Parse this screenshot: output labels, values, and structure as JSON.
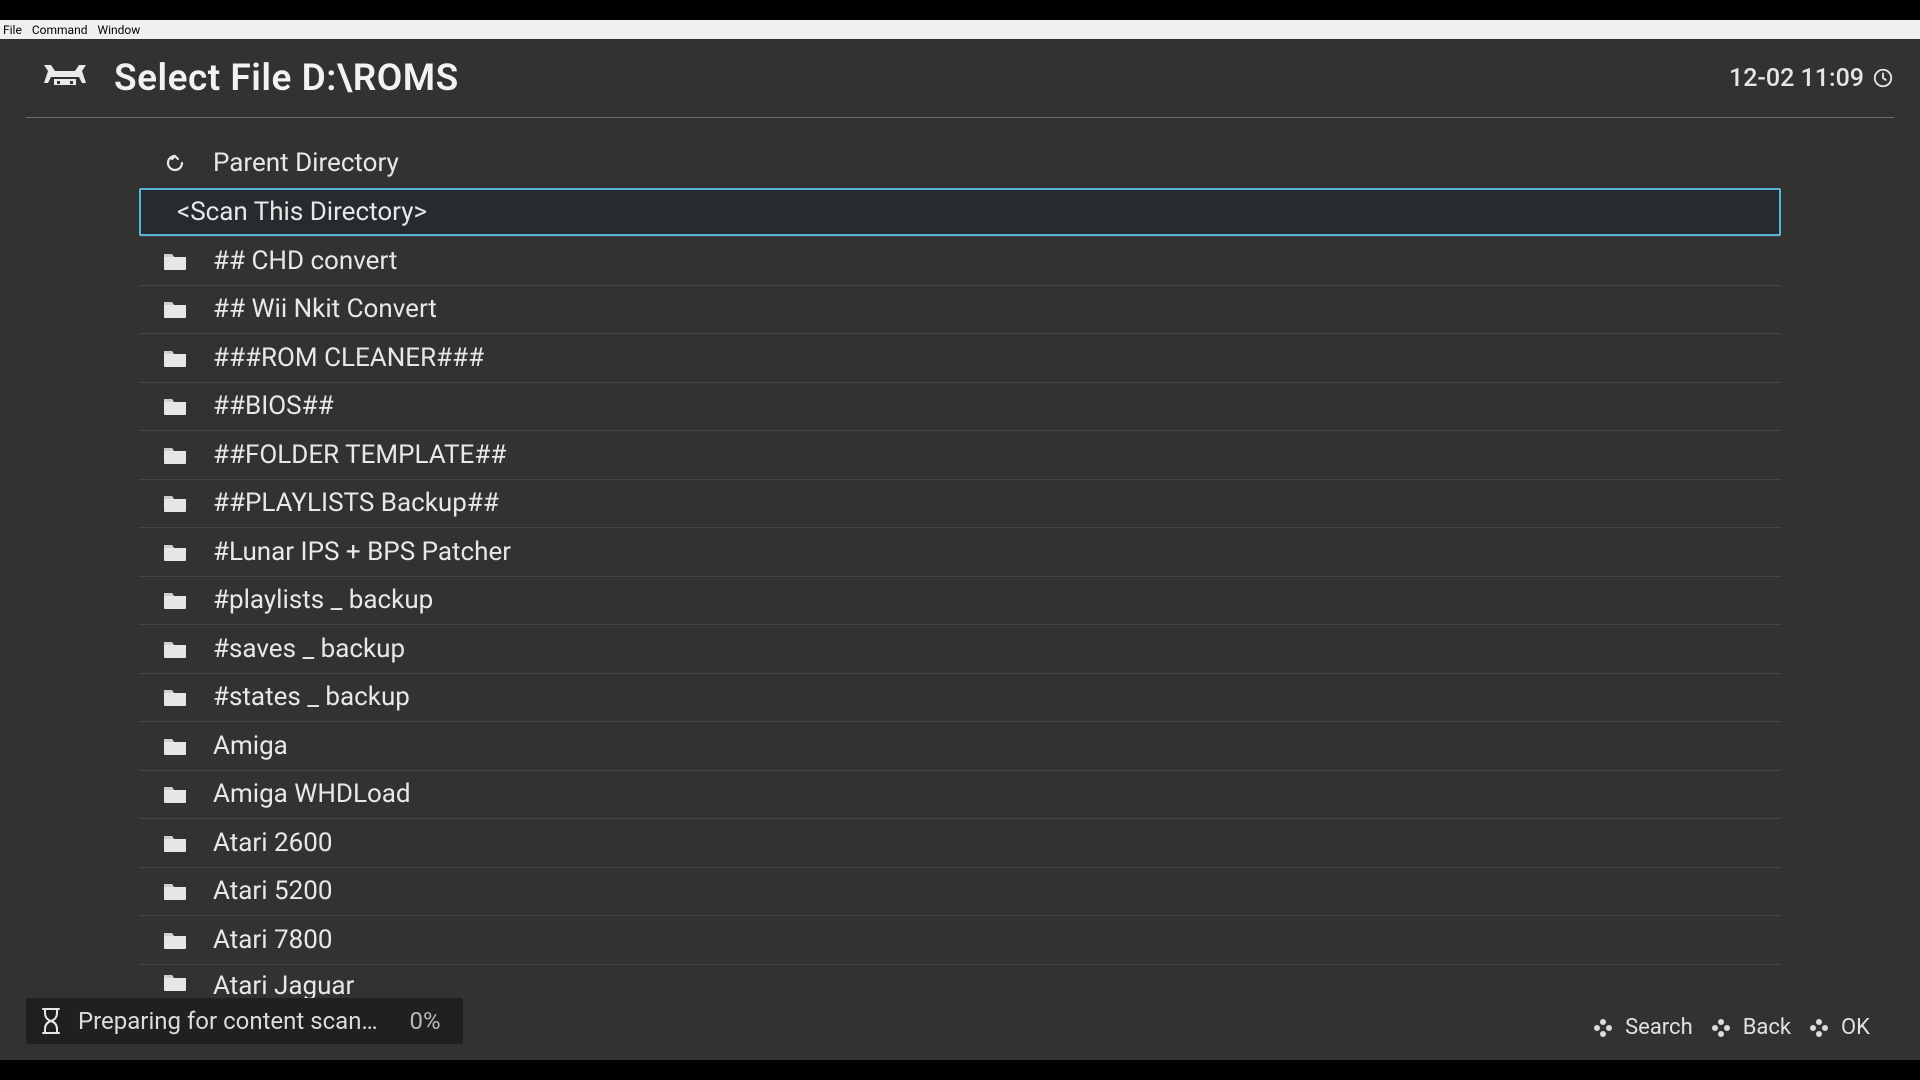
{
  "menubar": {
    "items": [
      "File",
      "Command",
      "Window"
    ]
  },
  "header": {
    "title": "Select File D:\\ROMS",
    "clock": "12-02 11:09"
  },
  "list": {
    "parent_label": "Parent Directory",
    "scan_label": "<Scan This Directory>",
    "folders": [
      "## CHD convert",
      "## Wii Nkit Convert",
      "###ROM CLEANER###",
      "##BIOS##",
      "##FOLDER TEMPLATE##",
      "##PLAYLISTS Backup##",
      "#Lunar IPS + BPS Patcher",
      "#playlists _ backup",
      "#saves _ backup",
      "#states _ backup",
      "Amiga",
      "Amiga WHDLoad",
      "Atari 2600",
      "Atari 5200",
      "Atari 7800",
      "Atari Jaguar"
    ]
  },
  "status": {
    "text": "Preparing for content scan…",
    "percent": "0%"
  },
  "footer": {
    "search": "Search",
    "back": "Back",
    "ok": "OK"
  }
}
